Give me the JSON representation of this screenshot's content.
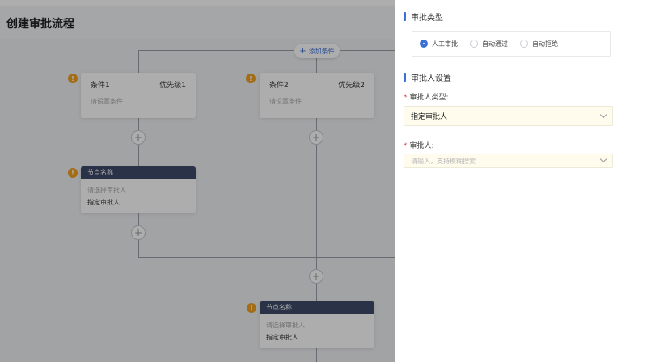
{
  "page": {
    "title": "创建审批流程"
  },
  "flow": {
    "add_condition": {
      "icon": "plus-icon",
      "label": "添加条件"
    },
    "conditions": [
      {
        "name": "条件1",
        "priority": "优先级1",
        "hint": "请设置条件"
      },
      {
        "name": "条件2",
        "priority": "优先级2",
        "hint": "请设置条件"
      }
    ],
    "nodes": [
      {
        "title": "节点名称",
        "hint": "请选择审批人",
        "value": "指定审批人"
      },
      {
        "title": "节点名称",
        "hint": "请选择审批人",
        "value": "指定审批人"
      }
    ],
    "warning_glyph": "!",
    "plus_glyph": "+"
  },
  "drawer": {
    "approval_type": {
      "title": "审批类型",
      "options": [
        "人工审批",
        "自动通过",
        "自动拒绝"
      ],
      "selected": "人工审批"
    },
    "approver_settings": {
      "title": "审批人设置",
      "type_label": "审批人类型:",
      "type_value": "指定审批人",
      "approver_label": "审批人:",
      "approver_placeholder": "请输入，支持模糊搜索",
      "required_mark": "*"
    }
  },
  "colors": {
    "accent": "#3b6fd8",
    "node_header": "#3e4b6b",
    "warning": "#f0a020",
    "required": "#e53935"
  }
}
